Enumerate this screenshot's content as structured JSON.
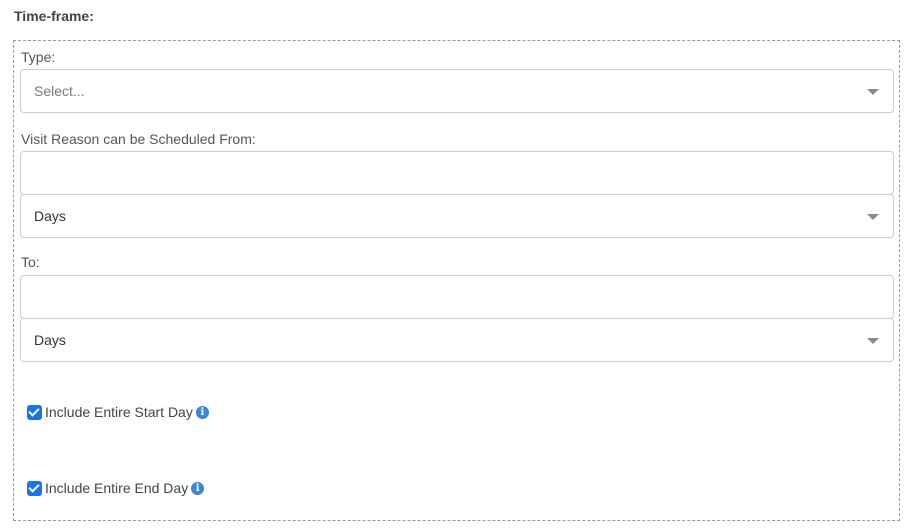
{
  "section": {
    "title": "Time-frame:"
  },
  "type_field": {
    "label": "Type:",
    "placeholder": "Select..."
  },
  "from_field": {
    "label": "Visit Reason can be Scheduled From:",
    "value": "",
    "unit": "Days"
  },
  "to_field": {
    "label": "To:",
    "value": "",
    "unit": "Days"
  },
  "checkboxes": [
    {
      "label": "Include Entire Start Day",
      "checked": true,
      "icon": "info-icon"
    },
    {
      "label": "Include Entire End Day",
      "checked": true,
      "icon": "info-icon"
    }
  ],
  "colors": {
    "checkbox": "#1a73e8",
    "info_icon": "#3a87d6"
  }
}
